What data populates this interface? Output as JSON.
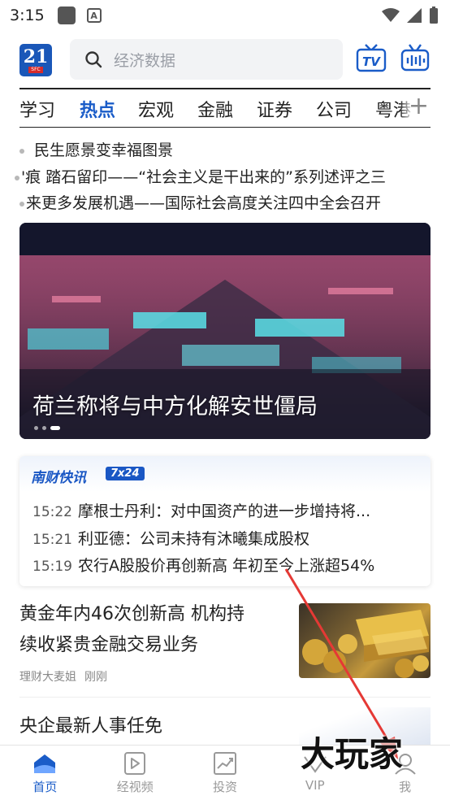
{
  "status_bar": {
    "time": "3:15"
  },
  "header": {
    "logo_number": "21",
    "logo_sub": "SFC",
    "search_placeholder": "经济数据"
  },
  "tabs": [
    {
      "label": "学习",
      "active": false
    },
    {
      "label": "热点",
      "active": true
    },
    {
      "label": "宏观",
      "active": false
    },
    {
      "label": "金融",
      "active": false
    },
    {
      "label": "证券",
      "active": false
    },
    {
      "label": "公司",
      "active": false
    },
    {
      "label": "粤港",
      "active": false
    }
  ],
  "ticker": [
    "民生愿景变幸福图景",
    "'痕 踏石留印——“社会主义是干出来的”系列述评之三",
    "来更多发展机遇——国际社会高度关注四中全会召开"
  ],
  "banner": {
    "title": "荷兰称将与中方化解安世僵局"
  },
  "flash": {
    "brand": "南财快讯",
    "badge": "7x24",
    "items": [
      {
        "time": "15:22",
        "text": "摩根士丹利：对中国资产的进一步增持将..."
      },
      {
        "time": "15:21",
        "text": "利亚德：公司未持有沐曦集成股权"
      },
      {
        "time": "15:19",
        "text": "农行A股股价再创新高 年初至今上涨超54%"
      }
    ]
  },
  "news": [
    {
      "title_line1": "黄金年内46次创新高 机构持",
      "title_line2": "续收紧贵金融交易业务",
      "source": "理财大麦姐",
      "time": "刚刚"
    },
    {
      "title_line1": "央企最新人事任免"
    }
  ],
  "bottom_nav": [
    {
      "label": "首页",
      "icon": "home-icon",
      "active": true
    },
    {
      "label": "经视频",
      "icon": "video-icon",
      "active": false
    },
    {
      "label": "投资",
      "icon": "chart-icon",
      "active": false
    },
    {
      "label": "VIP",
      "icon": "vip-icon",
      "active": false
    },
    {
      "label": "我",
      "icon": "profile-icon",
      "active": false
    }
  ],
  "watermark": "大玩家",
  "colors": {
    "accent": "#1a5cc8",
    "arrow": "#e53935"
  }
}
